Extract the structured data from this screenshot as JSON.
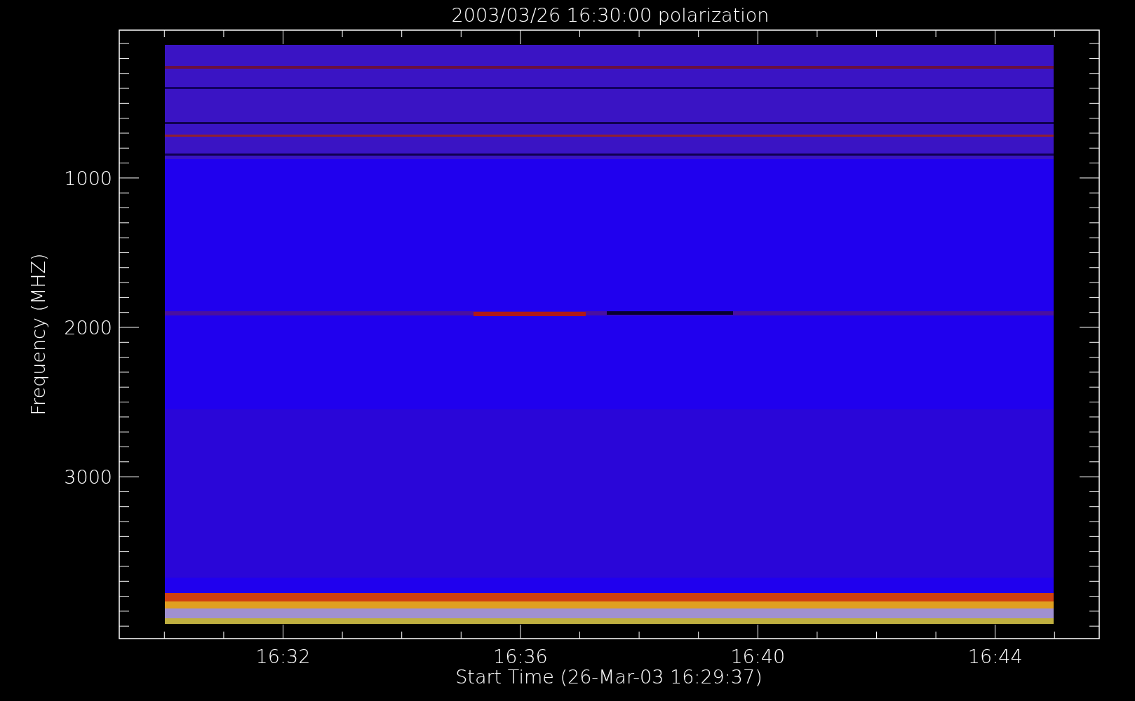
{
  "plot": {
    "title": "2003/03/26 16:30:00 polarization",
    "xlabel": "Start Time (26-Mar-03 16:29:37)",
    "ylabel": "Frequency (MHZ)",
    "xticks": [
      "16:32",
      "16:36",
      "16:40",
      "16:44"
    ],
    "yticks": [
      "1000",
      "2000",
      "3000"
    ],
    "spectrogram": {
      "kind": "picture"
    }
  }
}
